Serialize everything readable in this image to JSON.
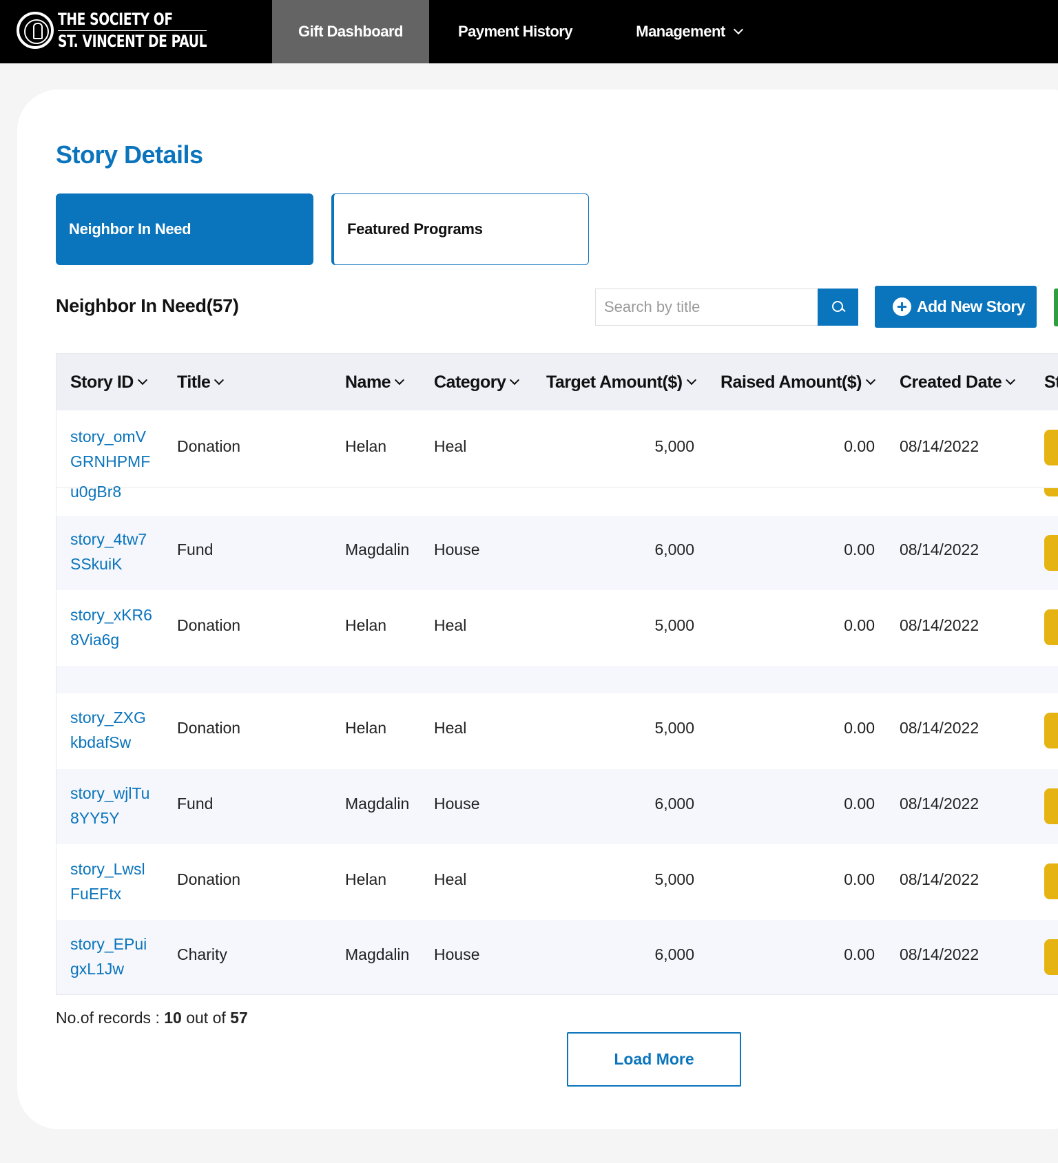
{
  "nav": {
    "logo_line1": "THE SOCIETY OF",
    "logo_line2": "ST. VINCENT DE PAUL",
    "items": [
      {
        "label": "Gift Dashboard"
      },
      {
        "label": "Payment History"
      },
      {
        "label": "Management"
      }
    ]
  },
  "page": {
    "title": "Story Details"
  },
  "tabs": [
    {
      "label": "Neighbor In Need"
    },
    {
      "label": "Featured Programs"
    }
  ],
  "section": {
    "title": "Neighbor In Need(57)"
  },
  "search": {
    "placeholder": "Search by title"
  },
  "add_button": {
    "label": "Add New Story"
  },
  "table": {
    "columns": [
      "Story ID",
      "Title",
      "Name",
      "Category",
      "Target Amount($)",
      "Raised Amount($)",
      "Created Date",
      "St"
    ],
    "partial_id": "u0gBr8",
    "rows": [
      {
        "id_line1": "story_omV",
        "id_line2": "GRNHPMF",
        "title": "Donation",
        "name": "Helan",
        "category": "Heal",
        "target": "5,000",
        "raised": "0.00",
        "date": "08/14/2022"
      },
      {
        "id_line1": "story_4tw7",
        "id_line2": "SSkuiK",
        "title": "Fund",
        "name": "Magdalin",
        "category": "House",
        "target": "6,000",
        "raised": "0.00",
        "date": "08/14/2022"
      },
      {
        "id_line1": "story_xKR6",
        "id_line2": "8Via6g",
        "title": "Donation",
        "name": "Helan",
        "category": "Heal",
        "target": "5,000",
        "raised": "0.00",
        "date": "08/14/2022"
      },
      {
        "id_line1": "story_ZXG",
        "id_line2": "kbdafSw",
        "title": "Donation",
        "name": "Helan",
        "category": "Heal",
        "target": "5,000",
        "raised": "0.00",
        "date": "08/14/2022"
      },
      {
        "id_line1": "story_wjlTu",
        "id_line2": "8YY5Y",
        "title": "Fund",
        "name": "Magdalin",
        "category": "House",
        "target": "6,000",
        "raised": "0.00",
        "date": "08/14/2022"
      },
      {
        "id_line1": "story_Lwsl",
        "id_line2": "FuEFtx",
        "title": "Donation",
        "name": "Helan",
        "category": "Heal",
        "target": "5,000",
        "raised": "0.00",
        "date": "08/14/2022"
      },
      {
        "id_line1": "story_EPui",
        "id_line2": "gxL1Jw",
        "title": "Charity",
        "name": "Magdalin",
        "category": "House",
        "target": "6,000",
        "raised": "0.00",
        "date": "08/14/2022"
      }
    ]
  },
  "footer": {
    "records_label": "No.of records :",
    "records_shown": "10",
    "records_out_of": "out of",
    "records_total": "57",
    "load_more": "Load More"
  },
  "colors": {
    "primary": "#0a74bc",
    "nav_bg": "#000000",
    "nav_active": "#646464",
    "action": "#e5b412",
    "accent_green": "#2e9e3f"
  }
}
